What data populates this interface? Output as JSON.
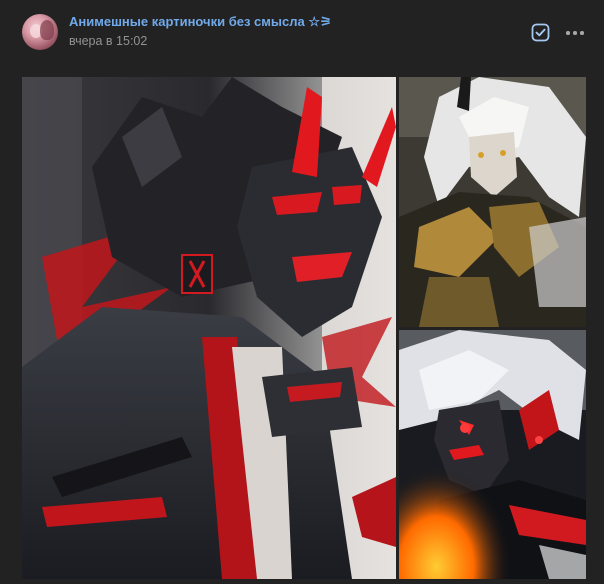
{
  "post": {
    "author": "Анимешные картиночки без смысла ☆⚞",
    "time": "вчера в 15:02"
  },
  "actions": {
    "check_icon": "checkbox-check-icon",
    "more_icon": "ellipsis-icon"
  },
  "gallery": {
    "photos": [
      {
        "subject": "anime character in black-red oni mask"
      },
      {
        "subject": "white-haired horned character in gold armor"
      },
      {
        "subject": "white-haired character with glowing red cracks"
      }
    ]
  },
  "colors": {
    "background": "#222222",
    "link": "#71aaeb",
    "meta": "#939393",
    "accent_red": "#d11a1f"
  }
}
